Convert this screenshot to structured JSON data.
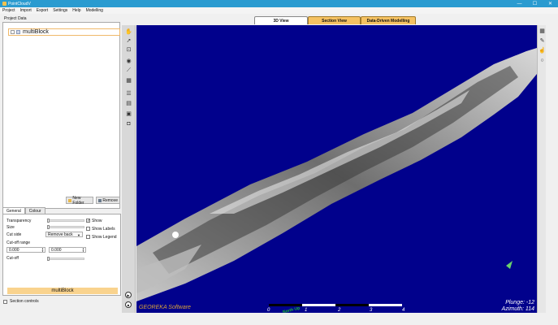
{
  "window": {
    "title": "PointCloudV",
    "controls": [
      "—",
      "☐",
      "✕"
    ]
  },
  "menu": [
    "Project",
    "Import",
    "Export",
    "Settings",
    "Help",
    "Modelling"
  ],
  "project": {
    "title": "Project Data",
    "tree_item": "multiBlock",
    "new_folder_label": "New Folder",
    "remove_label": "Remove"
  },
  "settings": {
    "tabs": [
      "General",
      "Colour"
    ],
    "transparency_label": "Transparency",
    "size_label": "Size",
    "cut_side_label": "Cut side",
    "cut_side_value": "Remove back",
    "cut_off_range_label": "Cut-off range",
    "range_min": "0.000",
    "range_max": "0.000",
    "cut_off_label": "Cut-off",
    "show_label": "Show",
    "show_checked": true,
    "show_labels_label": "Show Labels",
    "show_labels_checked": false,
    "show_legend_label": "Show Legend",
    "show_legend_checked": false,
    "transparency": 0,
    "size": 0,
    "cut_off": 0,
    "selected_name": "multiBlock"
  },
  "section_controls_label": "Section controls",
  "view_tabs": [
    "3D View",
    "Section View",
    "Data-Driven Modelling"
  ],
  "active_view_tab": "3D View",
  "viewport": {
    "background": "#01018c",
    "logo": "GEOREKA Software",
    "plunge": "Plunge: -12",
    "azimuth": "Azimuth: 114",
    "scale_ticks": [
      "0",
      "1",
      "2",
      "3",
      "4"
    ],
    "north_label": "North Up"
  },
  "toolbar_icons": [
    "hand-icon",
    "select-arrow-icon",
    "lock-icon",
    "eye-icon",
    "line-tool-icon",
    "table-icon",
    "section-icon",
    "layers-icon",
    "save-icon",
    "cube-icon"
  ],
  "right_toolbar_icons": [
    "edit-icon",
    "pen-icon",
    "pointer-icon",
    "circle-icon"
  ],
  "colors": {
    "accent": "#2a9bd0",
    "tab_inactive": "#f5c262",
    "highlight": "#f9d38e"
  }
}
